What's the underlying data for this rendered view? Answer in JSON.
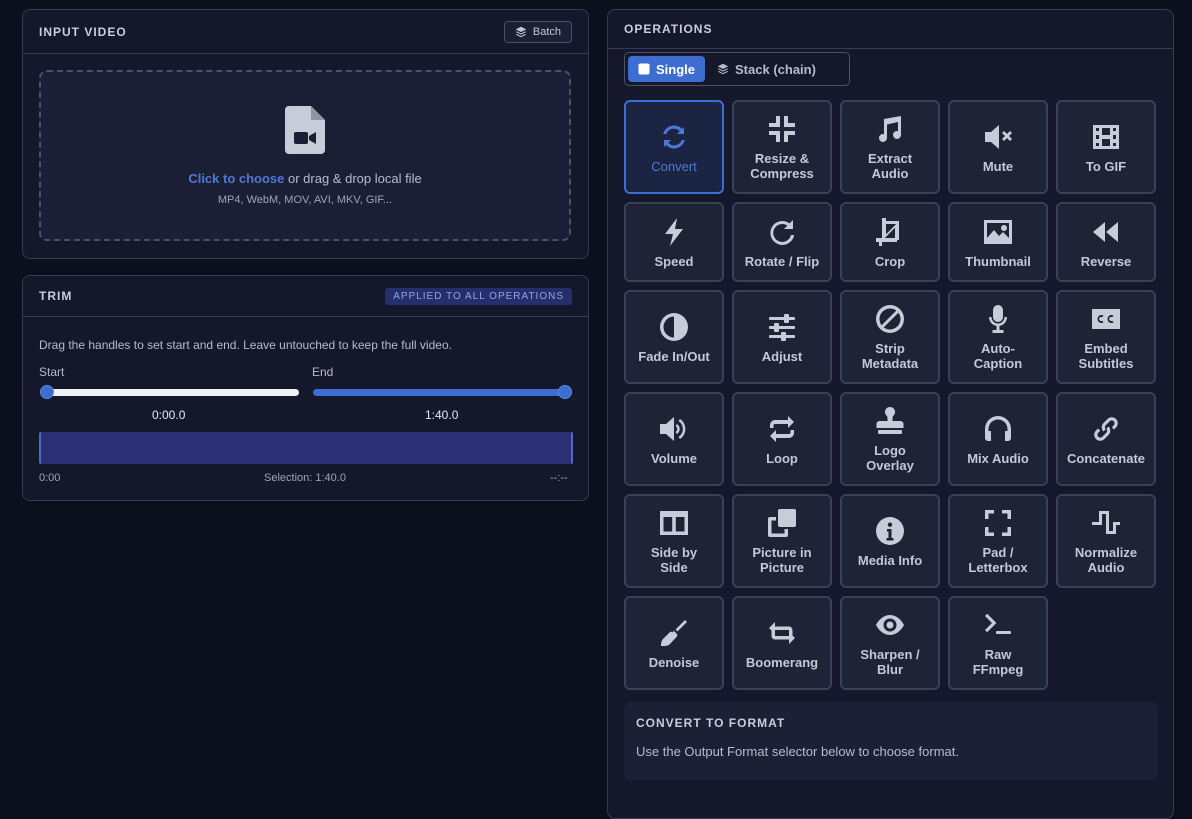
{
  "input": {
    "title": "INPUT VIDEO",
    "batch_label": "Batch",
    "drop_link": "Click to choose",
    "drop_text": " or drag & drop local file",
    "formats": "MP4, WebM, MOV, AVI, MKV, GIF..."
  },
  "trim": {
    "title": "TRIM",
    "badge": "APPLIED TO ALL OPERATIONS",
    "help": "Drag the handles to set start and end. Leave untouched to keep the full video.",
    "start_label": "Start",
    "end_label": "End",
    "start_value": "0:00.0",
    "end_value": "1:40.0",
    "timeline_start": "0:00",
    "selection": "Selection: 1:40.0",
    "timeline_end": "--:--",
    "start_fraction": 0,
    "end_fraction": 1
  },
  "operations": {
    "title": "OPERATIONS",
    "mode_single": "Single",
    "mode_stack": "Stack (chain)",
    "tiles": [
      {
        "label": "Convert",
        "icon": "sync-icon"
      },
      {
        "label": "Resize &\nCompress",
        "icon": "compress-icon"
      },
      {
        "label": "Extract\nAudio",
        "icon": "music-icon"
      },
      {
        "label": "Mute",
        "icon": "volume-mute-icon"
      },
      {
        "label": "To GIF",
        "icon": "film-icon"
      },
      {
        "label": "Speed",
        "icon": "bolt-icon"
      },
      {
        "label": "Rotate / Flip",
        "icon": "rotate-icon"
      },
      {
        "label": "Crop",
        "icon": "crop-icon"
      },
      {
        "label": "Thumbnail",
        "icon": "image-icon"
      },
      {
        "label": "Reverse",
        "icon": "backward-icon"
      },
      {
        "label": "Fade In/Out",
        "icon": "half-circle-icon"
      },
      {
        "label": "Adjust",
        "icon": "sliders-icon"
      },
      {
        "label": "Strip\nMetadata",
        "icon": "ban-icon"
      },
      {
        "label": "Auto-\nCaption",
        "icon": "microphone-icon"
      },
      {
        "label": "Embed\nSubtitles",
        "icon": "closed-captioning-icon"
      },
      {
        "label": "Volume",
        "icon": "volume-up-icon"
      },
      {
        "label": "Loop",
        "icon": "loop-icon"
      },
      {
        "label": "Logo\nOverlay",
        "icon": "stamp-icon"
      },
      {
        "label": "Mix Audio",
        "icon": "headphones-icon"
      },
      {
        "label": "Concatenate",
        "icon": "link-icon"
      },
      {
        "label": "Side by\nSide",
        "icon": "columns-icon"
      },
      {
        "label": "Picture in\nPicture",
        "icon": "clone-icon"
      },
      {
        "label": "Media Info",
        "icon": "info-icon"
      },
      {
        "label": "Pad /\nLetterbox",
        "icon": "expand-icon"
      },
      {
        "label": "Normalize\nAudio",
        "icon": "wave-square-icon"
      },
      {
        "label": "Denoise",
        "icon": "broom-icon"
      },
      {
        "label": "Boomerang",
        "icon": "repeat-icon"
      },
      {
        "label": "Sharpen /\nBlur",
        "icon": "eye-icon"
      },
      {
        "label": "Raw\nFFmpeg",
        "icon": "terminal-icon"
      }
    ],
    "convert_title": "CONVERT TO FORMAT",
    "convert_desc": "Use the Output Format selector below to choose format."
  },
  "colors": {
    "accent": "#3e6dd1",
    "background": "#0c0f1c",
    "panel": "#14182a",
    "tile": "#1e2336"
  }
}
